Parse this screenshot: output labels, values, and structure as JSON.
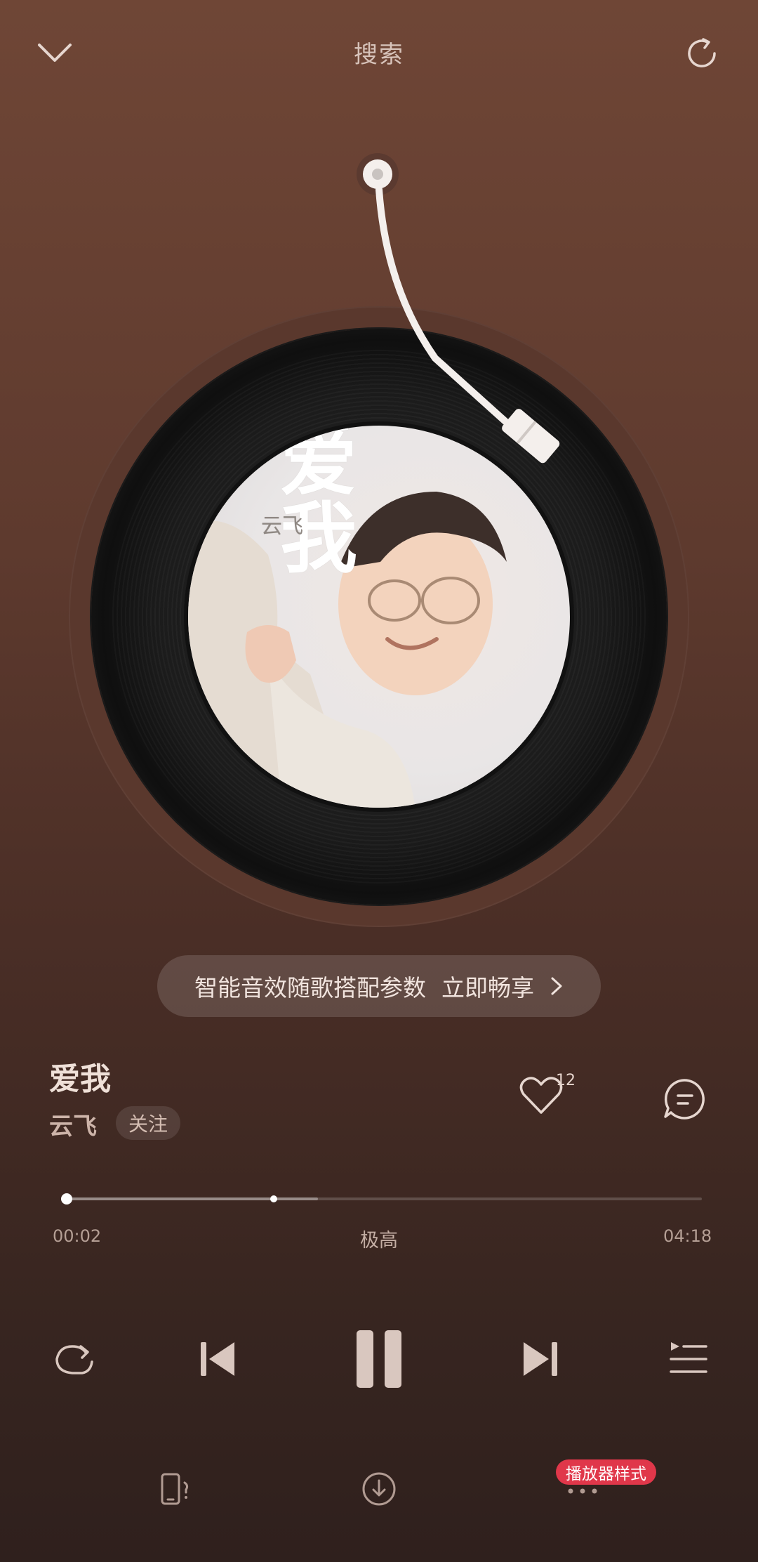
{
  "header": {
    "title": "搜索",
    "back_icon": "chevron-down-icon",
    "share_icon": "share-icon"
  },
  "cover": {
    "text_main": "爱我",
    "text_artist": "云飞"
  },
  "enhance": {
    "text": "智能音效随歌搭配参数",
    "action": "立即畅享",
    "chevron": "›"
  },
  "song": {
    "title": "爱我",
    "artist": "云飞",
    "follow_label": "关注",
    "like_count": "12"
  },
  "progress": {
    "current": "00:02",
    "total": "04:18",
    "quality": "极高",
    "played_fraction": 0.008,
    "buffered_fraction": 0.4
  },
  "bottom": {
    "style_badge": "播放器样式"
  },
  "colors": {
    "accent_red": "#e0374a",
    "background_top": "#6f4636",
    "background_bottom": "#2f201d"
  }
}
